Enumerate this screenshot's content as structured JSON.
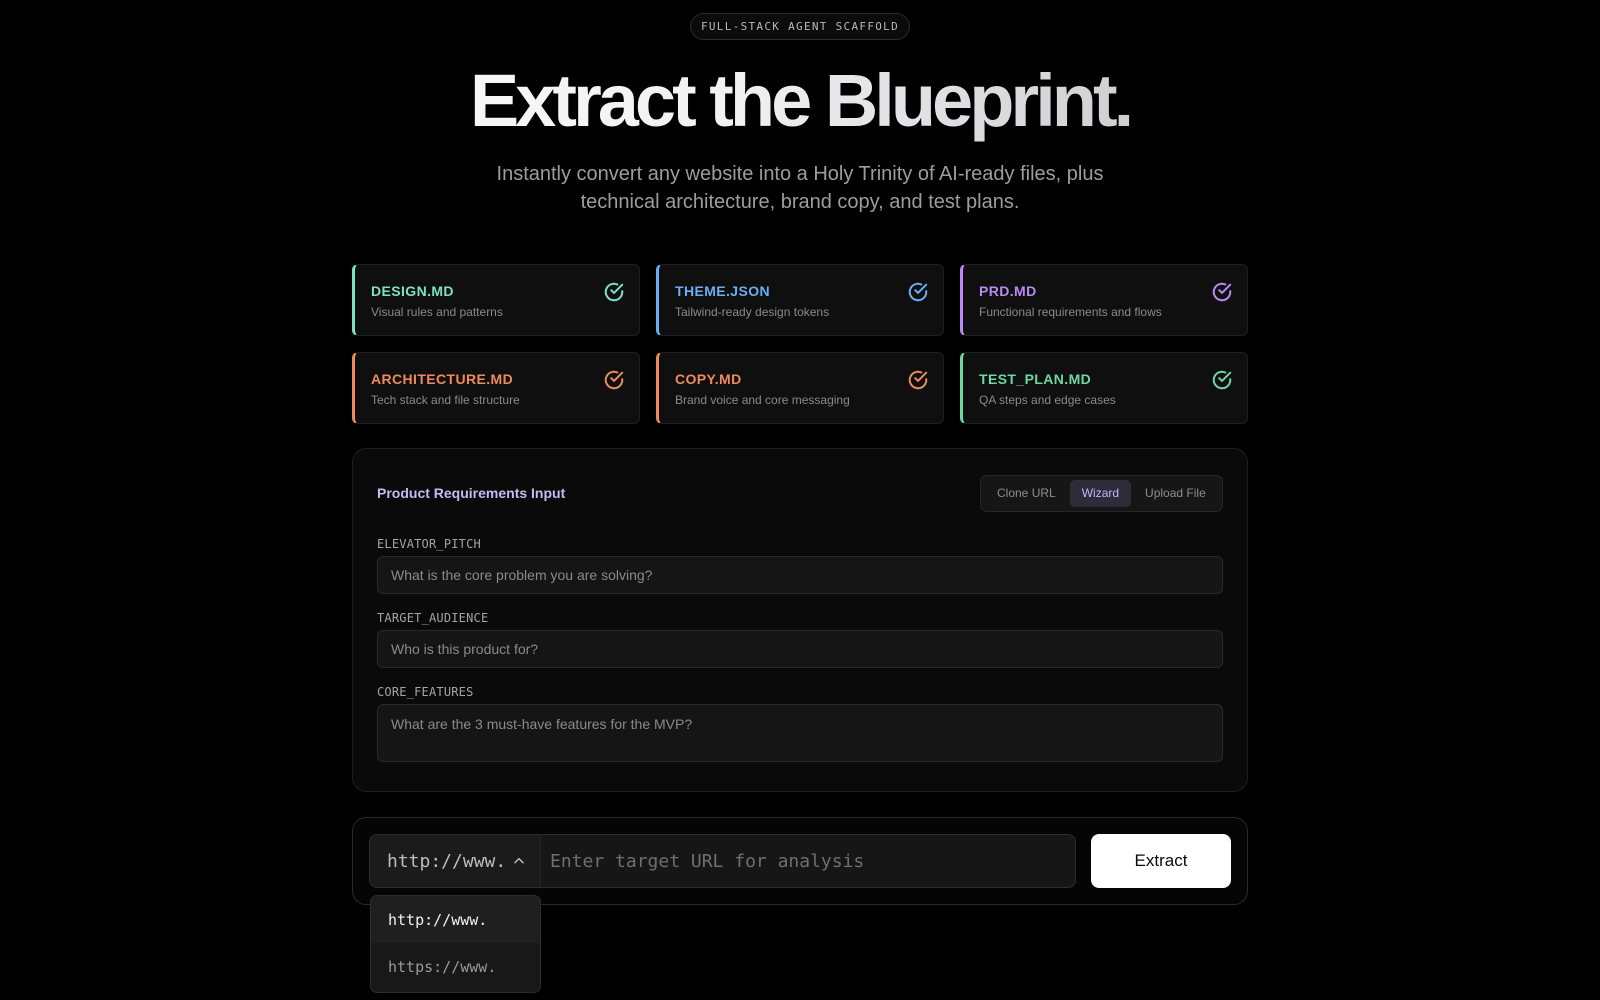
{
  "badge": "FULL-STACK AGENT SCAFFOLD",
  "hero": {
    "title": "Extract the Blueprint.",
    "subtitle_line1": "Instantly convert any website into a Holy Trinity of AI-ready files, plus",
    "subtitle_line2": "technical architecture, brand copy, and test plans."
  },
  "cards": [
    {
      "title": "DESIGN.MD",
      "desc": "Visual rules and patterns",
      "accent": "#7ee0c6",
      "icon": "check-circle-icon"
    },
    {
      "title": "THEME.JSON",
      "desc": "Tailwind-ready design tokens",
      "accent": "#6aaef5",
      "icon": "check-circle-icon"
    },
    {
      "title": "PRD.MD",
      "desc": "Functional requirements and flows",
      "accent": "#b98af5",
      "icon": "check-circle-icon"
    },
    {
      "title": "ARCHITECTURE.MD",
      "desc": "Tech stack and file structure",
      "accent": "#f08a5d",
      "icon": "check-circle-icon"
    },
    {
      "title": "COPY.MD",
      "desc": "Brand voice and core messaging",
      "accent": "#f08a5d",
      "icon": "check-circle-icon"
    },
    {
      "title": "TEST_PLAN.MD",
      "desc": "QA steps and edge cases",
      "accent": "#6fd6a4",
      "icon": "check-circle-icon"
    }
  ],
  "panel": {
    "title": "Product Requirements Input",
    "tabs": [
      "Clone URL",
      "Wizard",
      "Upload File"
    ],
    "active_tab": "Wizard",
    "fields": [
      {
        "label": "ELEVATOR_PITCH",
        "placeholder": "What is the core problem you are solving?",
        "value": ""
      },
      {
        "label": "TARGET_AUDIENCE",
        "placeholder": "Who is this product for?",
        "value": ""
      },
      {
        "label": "CORE_FEATURES",
        "placeholder": "What are the 3 must-have features for the MVP?",
        "value": ""
      }
    ]
  },
  "url_bar": {
    "protocol": "http://www.",
    "placeholder": "Enter target URL for analysis",
    "value": "",
    "button": "Extract",
    "chevron_icon": "chevron-up-icon"
  },
  "dropdown": {
    "options": [
      "http://www.",
      "https://www."
    ],
    "selected": "http://www."
  },
  "colors": {
    "background": "#000000",
    "accent_purple": "#c4b5fd",
    "button_bg": "#ffffff"
  }
}
